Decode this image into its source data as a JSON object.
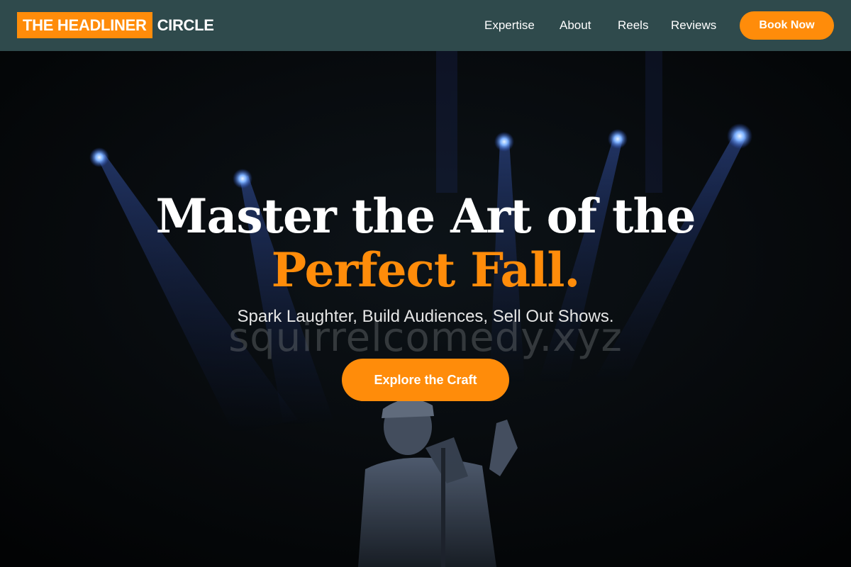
{
  "brand": {
    "highlight": "THE HEADLINER",
    "rest": "CIRCLE"
  },
  "nav": {
    "items": [
      {
        "label": "Expertise"
      },
      {
        "label": "About"
      },
      {
        "label": "Reels"
      },
      {
        "label": "Reviews"
      }
    ],
    "book_label": "Book Now"
  },
  "hero": {
    "headline_line1": "Master the Art of the",
    "headline_line2": "Perfect Fall.",
    "watermark": "squirrelcomedy.xyz",
    "subheadline": "Spark Laughter, Build Audiences, Sell Out Shows.",
    "cta_label": "Explore the Craft",
    "background": "stage-performer-photo"
  },
  "colors": {
    "accent": "#ff8c0a",
    "header_bg": "#2f4a4c",
    "hero_bg": "#050607",
    "text": "#ffffff"
  }
}
